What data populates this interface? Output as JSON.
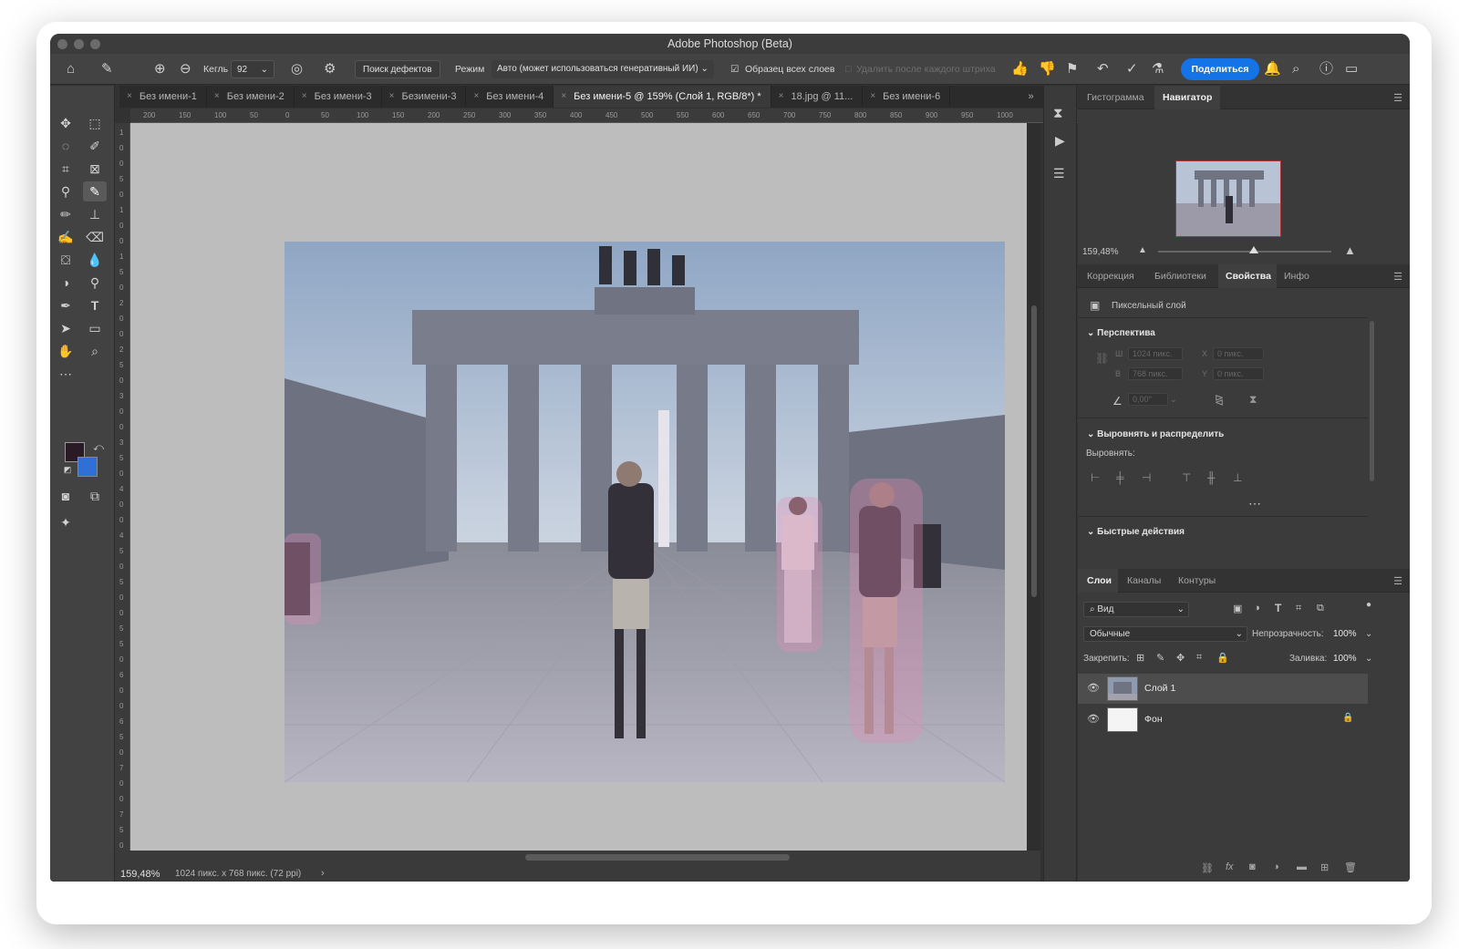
{
  "window": {
    "title": "Adobe Photoshop (Beta)"
  },
  "options": {
    "size_label": "Кегль",
    "size_value": "92",
    "defects_button": "Поиск дефектов",
    "mode_label": "Режим",
    "mode_value": "Авто (может использоваться генеративный ИИ)",
    "sample_all_label": "Образец всех слоев",
    "remove_after_label": "Удалить после каждого штриха",
    "share_label": "Поделиться"
  },
  "tabs": [
    {
      "label": "Без имени-1"
    },
    {
      "label": "Без имени-2"
    },
    {
      "label": "Без имени-3"
    },
    {
      "label": "Безимени-3"
    },
    {
      "label": "Без имени-4"
    },
    {
      "label": "Без имени-5 @ 159% (Слой 1, RGB/8*) *"
    },
    {
      "label": "18.jpg @ 11..."
    },
    {
      "label": "Без имени-6"
    }
  ],
  "ruler_top": [
    "200",
    "150",
    "100",
    "50",
    "0",
    "50",
    "100",
    "150",
    "200",
    "250",
    "300",
    "350",
    "400",
    "450",
    "500",
    "550",
    "600",
    "650",
    "700",
    "750",
    "800",
    "850",
    "900",
    "950",
    "1000"
  ],
  "ruler_left": [
    "1",
    "0",
    "0",
    "5",
    "0",
    "1",
    "0",
    "0",
    "1",
    "5",
    "0",
    "2",
    "0",
    "0",
    "2",
    "5",
    "0",
    "3",
    "0",
    "0",
    "3",
    "5",
    "0",
    "4",
    "0",
    "0",
    "4",
    "5",
    "0",
    "5",
    "0",
    "0",
    "5",
    "5",
    "0",
    "6",
    "0",
    "0",
    "6",
    "5",
    "0",
    "7",
    "0",
    "0",
    "7",
    "5",
    "0"
  ],
  "status": {
    "zoom": "159,48%",
    "doc_info": "1024 пикс. x 768 пикс. (72 ppi)"
  },
  "navigator": {
    "tab_histogram": "Гистограмма",
    "tab_navigator": "Навигатор",
    "zoom": "159,48%",
    "zoom_fraction": 0.55
  },
  "properties": {
    "tabs": [
      "Коррекция",
      "Библиотеки",
      "Свойства",
      "Инфо"
    ],
    "layer_type": "Пиксельный слой",
    "perspective_title": "Перспектива",
    "w_label": "Ш",
    "w_value": "1024 пикс.",
    "h_label": "В",
    "h_value": "768 пикс.",
    "x_label": "X",
    "x_value": "0 пикс.",
    "y_label": "Y",
    "y_value": "0 пикс.",
    "angle_value": "0,00°",
    "align_title": "Выровнять и распределить",
    "align_label": "Выровнять:",
    "quick_actions_title": "Быстрые действия"
  },
  "layers": {
    "tabs": [
      "Слои",
      "Каналы",
      "Контуры"
    ],
    "filter_placeholder": "Вид",
    "blend_mode": "Обычные",
    "opacity_label": "Непрозрачность:",
    "opacity_value": "100%",
    "lock_label": "Закрепить:",
    "fill_label": "Заливка:",
    "fill_value": "100%",
    "items": [
      {
        "name": "Слой 1",
        "selected": true
      },
      {
        "name": "Фон",
        "locked": true
      }
    ]
  },
  "colors": {
    "accent": "#1473e6",
    "foreground": "#2a1a26",
    "background": "#2f6fd6"
  }
}
